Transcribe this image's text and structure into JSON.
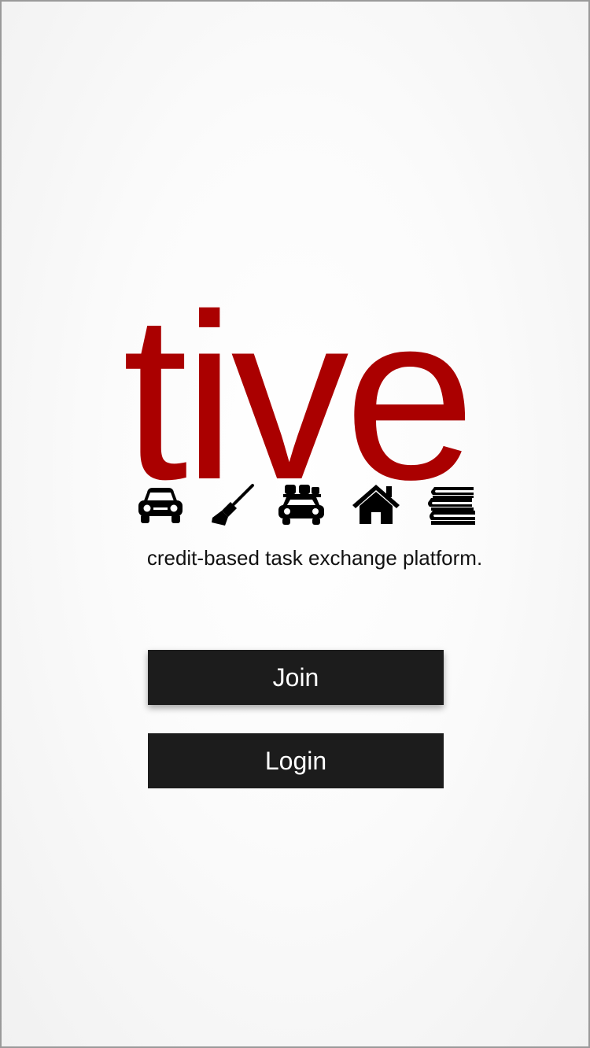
{
  "app": {
    "logo_text": "tive",
    "brand_color": "#aa0000"
  },
  "icons": [
    "car-icon",
    "broom-icon",
    "car-roof-rack-icon",
    "house-icon",
    "books-icon"
  ],
  "tagline": "credit-based task exchange platform.",
  "actions": {
    "join_label": "Join",
    "login_label": "Login",
    "button_color": "#1c1c1c"
  }
}
